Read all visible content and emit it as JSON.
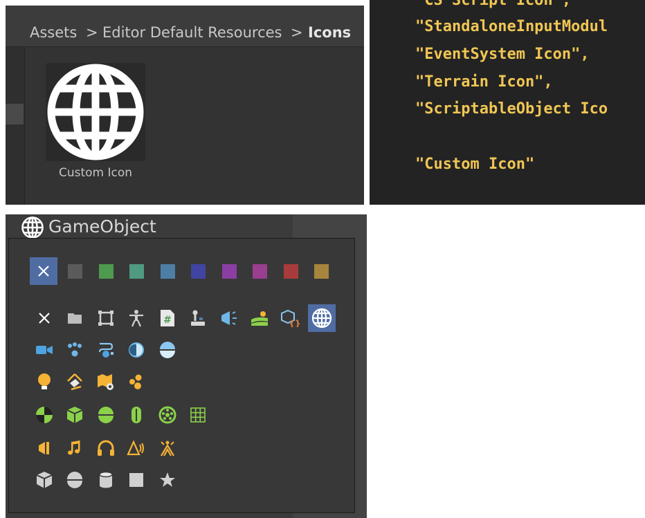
{
  "project_panel": {
    "breadcrumb": [
      "Assets",
      "Editor Default Resources",
      "Icons"
    ],
    "separator": ">",
    "asset_name": "Custom Icon"
  },
  "code_panel": {
    "lines": [
      "\"CS Script Icon\",",
      "\"StandaloneInputModul",
      "\"EventSystem Icon\",",
      "\"Terrain Icon\",",
      "\"ScriptableObject Ico",
      "",
      "\"Custom Icon\""
    ]
  },
  "icon_picker": {
    "object_name": "GameObject",
    "swatch_colors": [
      "#5b5b5b",
      "#4e9a4e",
      "#4f9a80",
      "#4d7fa6",
      "#3f45a0",
      "#8b3fa3",
      "#9a3e8f",
      "#a83c3c",
      "#a8853c"
    ],
    "selected_color": "#4f6da3",
    "icon_rows": [
      [
        "none-icon",
        "folder-icon",
        "rect-transform-icon",
        "avatar-icon",
        "csharp-script-icon",
        "joystick-icon",
        "audio-source-icon",
        "terrain-icon",
        "scriptable-object-icon",
        "globe-icon"
      ],
      [
        "camera-icon",
        "particle-system-icon",
        "animator-icon",
        "reflection-probe-icon",
        "sphere-half-icon"
      ],
      [
        "light-icon",
        "light-probe-icon",
        "navmesh-icon",
        "cluster-icon"
      ],
      [
        "physics-material-icon",
        "box-collider-icon",
        "sphere-collider-icon",
        "capsule-collider-icon",
        "wheel-collider-icon",
        "grid-icon"
      ],
      [
        "audio-speaker-icon",
        "music-note-icon",
        "headphones-icon",
        "audio-reverb-icon",
        "audio-chorus-icon"
      ],
      [
        "cube-icon",
        "capsule-mesh-icon",
        "cylinder-icon",
        "quad-icon",
        "star-icon"
      ]
    ]
  }
}
